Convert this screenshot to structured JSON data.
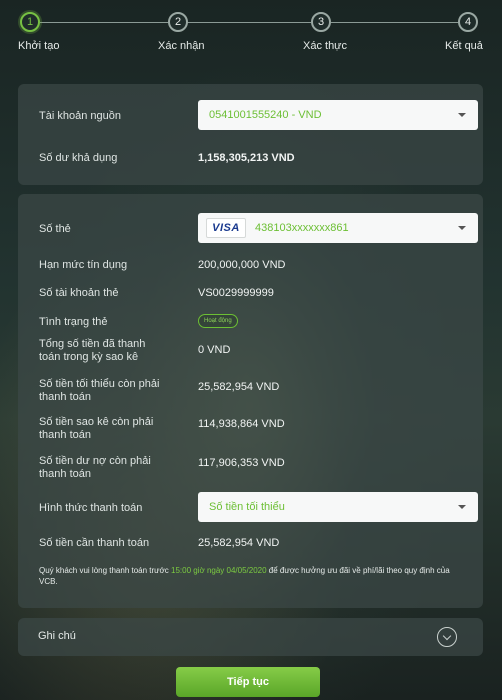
{
  "stepper": {
    "steps": [
      {
        "number": "1",
        "label": "Khởi tạo"
      },
      {
        "number": "2",
        "label": "Xác nhận"
      },
      {
        "number": "3",
        "label": "Xác thực"
      },
      {
        "number": "4",
        "label": "Kết quả"
      }
    ],
    "active_step": 1
  },
  "account": {
    "source_label": "Tài khoản nguồn",
    "source_value": "0541001555240 - VND",
    "balance_label": "Số dư khả dụng",
    "balance_value": "1,158,305,213 VND"
  },
  "card": {
    "card_label": "Số thẻ",
    "card_brand": "VISA",
    "card_number": "438103xxxxxxx861",
    "credit_limit_label": "Hạn mức tín dụng",
    "credit_limit_value": "200,000,000 VND",
    "card_account_label": "Số tài khoản thẻ",
    "card_account_value": "VS0029999999",
    "status_label": "Tình trạng thẻ",
    "status_value": "Hoạt động",
    "paid_label": "Tổng số tiền đã thanh toán trong kỳ sao kê",
    "paid_value": "0 VND",
    "min_due_label": "Số tiền tối thiểu còn phải thanh toán",
    "min_due_value": "25,582,954 VND",
    "statement_due_label": "Số tiền sao kê còn phải thanh toán",
    "statement_due_value": "114,938,864 VND",
    "debt_due_label": "Số tiền dư nợ còn phải thanh toán",
    "debt_due_value": "117,906,353 VND",
    "method_label": "Hình thức thanh toán",
    "method_value": "Số tiền tối thiểu",
    "amount_label": "Số tiền cần thanh toán",
    "amount_value": "25,582,954 VND",
    "note_prefix": "Quý khách vui lòng thanh toán trước ",
    "note_highlight": "15:00 giờ ngày 04/05/2020",
    "note_suffix": " để được hưởng ưu đãi về phí/lãi theo quy định của VCB."
  },
  "notes": {
    "label": "Ghi chú"
  },
  "actions": {
    "continue_label": "Tiếp tục"
  },
  "colors": {
    "accent": "#6cbf34",
    "button": "#6eb838",
    "panel": "#3c4846"
  }
}
